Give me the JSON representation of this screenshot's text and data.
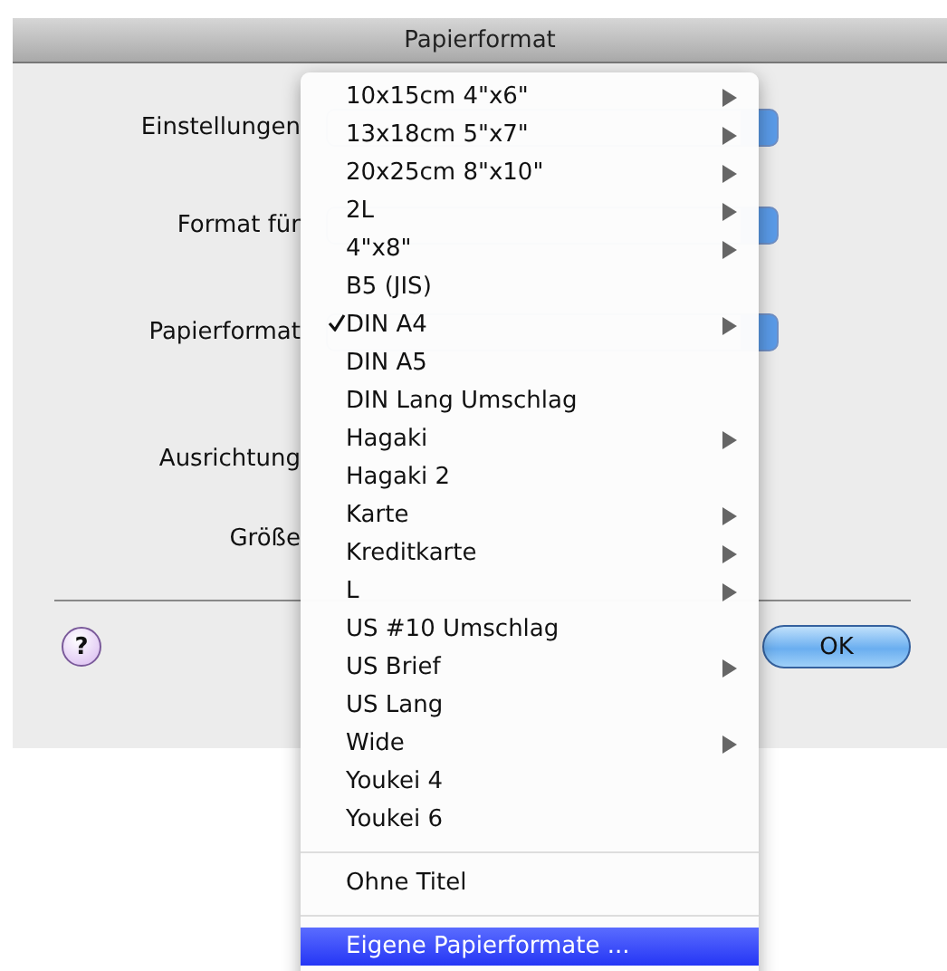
{
  "window": {
    "title": "Papierformat"
  },
  "form": {
    "rows": [
      {
        "label": "Einstellungen",
        "kind": "popup"
      },
      {
        "label": "Format für",
        "kind": "popup"
      },
      {
        "label": "Papierformat",
        "kind": "popup"
      },
      {
        "label": "Ausrichtung",
        "kind": "plain"
      },
      {
        "label": "Größe",
        "kind": "plain"
      }
    ]
  },
  "buttons": {
    "help": "?",
    "ok": "OK"
  },
  "menu": {
    "groups": [
      [
        {
          "label": "10x15cm 4\"x6\"",
          "checked": false,
          "submenu": true,
          "selected": false
        },
        {
          "label": "13x18cm 5\"x7\"",
          "checked": false,
          "submenu": true,
          "selected": false
        },
        {
          "label": "20x25cm 8\"x10\"",
          "checked": false,
          "submenu": true,
          "selected": false
        },
        {
          "label": "2L",
          "checked": false,
          "submenu": true,
          "selected": false
        },
        {
          "label": "4\"x8\"",
          "checked": false,
          "submenu": true,
          "selected": false
        },
        {
          "label": "B5 (JIS)",
          "checked": false,
          "submenu": false,
          "selected": false
        },
        {
          "label": "DIN A4",
          "checked": true,
          "submenu": true,
          "selected": false
        },
        {
          "label": "DIN A5",
          "checked": false,
          "submenu": false,
          "selected": false
        },
        {
          "label": "DIN Lang Umschlag",
          "checked": false,
          "submenu": false,
          "selected": false
        },
        {
          "label": "Hagaki",
          "checked": false,
          "submenu": true,
          "selected": false
        },
        {
          "label": "Hagaki 2",
          "checked": false,
          "submenu": false,
          "selected": false
        },
        {
          "label": "Karte",
          "checked": false,
          "submenu": true,
          "selected": false
        },
        {
          "label": "Kreditkarte",
          "checked": false,
          "submenu": true,
          "selected": false
        },
        {
          "label": "L",
          "checked": false,
          "submenu": true,
          "selected": false
        },
        {
          "label": "US #10 Umschlag",
          "checked": false,
          "submenu": false,
          "selected": false
        },
        {
          "label": "US Brief",
          "checked": false,
          "submenu": true,
          "selected": false
        },
        {
          "label": "US Lang",
          "checked": false,
          "submenu": false,
          "selected": false
        },
        {
          "label": "Wide",
          "checked": false,
          "submenu": true,
          "selected": false
        },
        {
          "label": "Youkei 4",
          "checked": false,
          "submenu": false,
          "selected": false
        },
        {
          "label": "Youkei 6",
          "checked": false,
          "submenu": false,
          "selected": false
        }
      ],
      [
        {
          "label": "Ohne Titel",
          "checked": false,
          "submenu": false,
          "selected": false
        }
      ],
      [
        {
          "label": "Eigene Papierformate ...",
          "checked": false,
          "submenu": false,
          "selected": true
        }
      ]
    ]
  }
}
